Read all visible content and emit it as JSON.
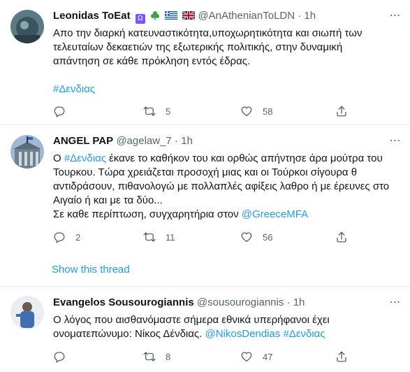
{
  "tweets": [
    {
      "name": "Leonidas ToEat",
      "name_badges": [
        "omega-badge-icon",
        "shamrock-icon",
        "greece-flag-icon",
        "uk-flag-icon"
      ],
      "handle": "@AnAthenianToLDN",
      "time": "1h",
      "text": "Απο την διαρκή κατευναστικότητα,υποχωρητικότητα και σιωπή των τελευταίων δεκαετιών της εξωτερικής πολιτικής, στην δυναμική απάντηση σε κάθε πρόκληση εντός έδρας.",
      "hashtag": "#Δενδιας",
      "reply_count": "",
      "retweet_count": "5",
      "like_count": "58"
    },
    {
      "name": "ANGEL PAP",
      "handle": "@agelaw_7",
      "time": "1h",
      "text_prefix": "Ο ",
      "text_hashtag": "#Δενδιας",
      "text_main": " έκανε το καθήκον του και ορθώς απήντησε άρα μούτρα του Τουρκου.  Τώρα χρειάζεται προσοχή μιας και οι Τούρκοι σίγουρα θ αντιδράσουν, πιθανολογώ με πολλαπλές αφίξεις  λαθρο ή με έρευνες στο Αιγαίο ή και με τα δύο...",
      "text_line2_prefix": "Σε καθε περίπτωση, συγχαρητήρια στον ",
      "text_mention": "@GreeceMFA",
      "reply_count": "2",
      "retweet_count": "11",
      "like_count": "56",
      "show_thread": "Show this thread"
    },
    {
      "name": "Evangelos Sousourogiannis",
      "handle": "@sousourogiannis",
      "time": "1h",
      "text_main": "Ο λόγος που αισθανόμαστε σήμερα εθνικά υπερήφανοι έχει ονοματεπώνυμο: Νίκος Δένδιας. ",
      "text_mention": "@NikosDendias",
      "text_hashtag": "#Δενδιας",
      "reply_count": "",
      "retweet_count": "8",
      "like_count": "47"
    }
  ],
  "separator": " · ",
  "colors": {
    "accent": "#1d9bf0",
    "muted": "#536471",
    "divider": "#ebeef0"
  }
}
